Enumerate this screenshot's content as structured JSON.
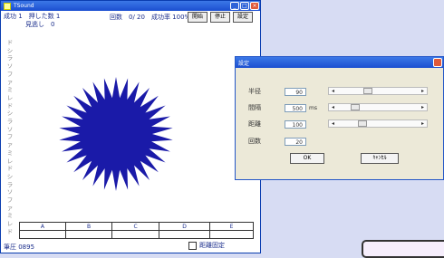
{
  "main_window": {
    "title": "TSound",
    "stats": {
      "line1": "成功 1　押した数 1",
      "line2": "見逃し　0"
    },
    "round_stats": "回数　0/ 20　成功率 100%",
    "buttons": {
      "start": "開始",
      "stop": "停止",
      "settings": "設定"
    },
    "side_labels": [
      "ド",
      "シ",
      "ラ",
      "ソ",
      "ファ",
      "ミ",
      "レ",
      "ド",
      "シ",
      "ラ",
      "ソ",
      "ファ",
      "ミ",
      "レ",
      "ド",
      "シ",
      "ラ",
      "ソ",
      "ファ",
      "ミ",
      "レ",
      "ド"
    ],
    "columns": [
      "A",
      "B",
      "C",
      "D",
      "E"
    ],
    "status": "筆圧 0895",
    "fix_distance_label": "距離固定",
    "star_color": "#1a1aa8"
  },
  "settings_dialog": {
    "title": "設定",
    "rows": [
      {
        "label": "半径",
        "value": "90",
        "unit": "",
        "slider": 0.35
      },
      {
        "label": "間隔",
        "value": "500",
        "unit": "ms",
        "slider": 0.18
      },
      {
        "label": "距離",
        "value": "100",
        "unit": "",
        "slider": 0.28
      },
      {
        "label": "回数",
        "value": "20",
        "unit": ""
      }
    ],
    "ok_label": "OK",
    "cancel_label": "ｷｬﾝｾﾙ"
  },
  "colors": {
    "title_blue": "#1c4fd0",
    "text_blue": "#1b2e8c",
    "background": "#d7dcf3"
  }
}
